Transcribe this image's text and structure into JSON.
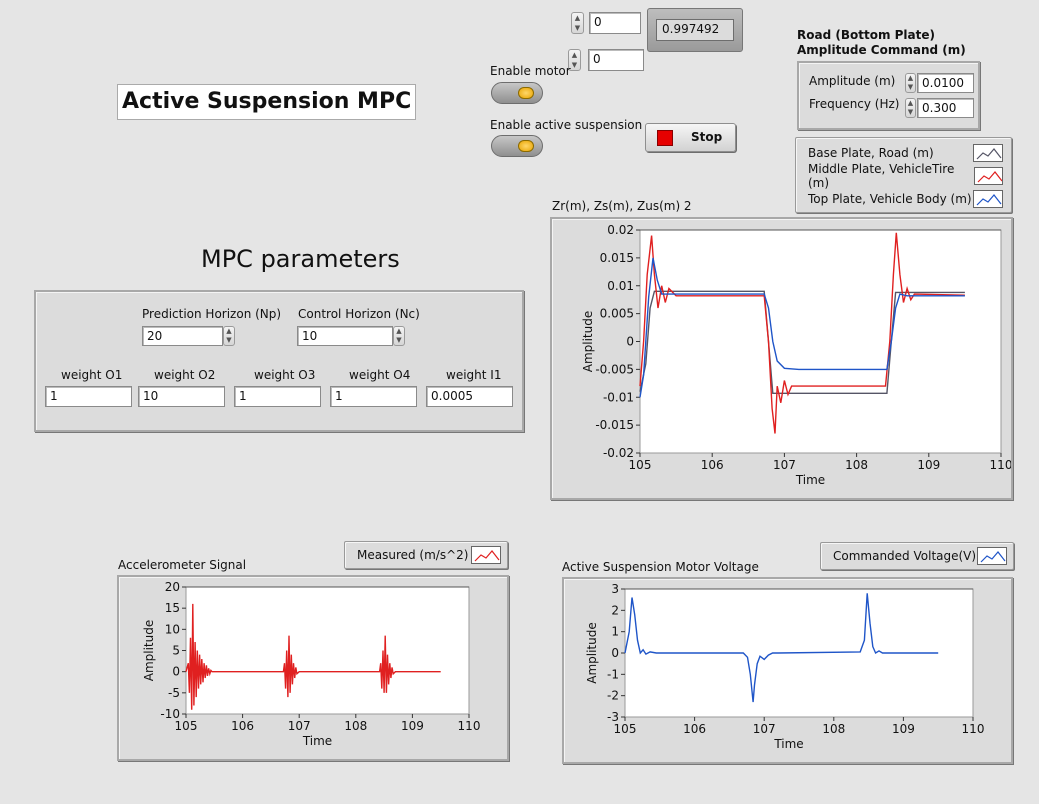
{
  "title": "Active Suspension MPC",
  "top_controls": {
    "numeric_1": "0",
    "numeric_2": "0",
    "indicator": "0.997492"
  },
  "enable_motor_label": "Enable motor",
  "enable_active_label": "Enable active suspension",
  "stop_label": "Stop",
  "road": {
    "title_line1": "Road (Bottom Plate)",
    "title_line2": "Amplitude Command (m)",
    "amplitude_label": "Amplitude (m)",
    "amplitude_value": "0.0100",
    "frequency_label": "Frequency (Hz)",
    "frequency_value": "0.300"
  },
  "plate_legend": [
    {
      "label": "Base Plate, Road (m)",
      "color": "#555566"
    },
    {
      "label": "Middle Plate, VehicleTire (m)",
      "color": "#e02020"
    },
    {
      "label": "Top Plate, Vehicle Body (m)",
      "color": "#1f55c8"
    }
  ],
  "mpc": {
    "heading": "MPC parameters",
    "np_label": "Prediction Horizon (Np)",
    "np_value": "20",
    "nc_label": "Control Horizon (Nc)",
    "nc_value": "10",
    "weights": [
      {
        "label": "weight O1",
        "value": "1"
      },
      {
        "label": "weight O2",
        "value": "10"
      },
      {
        "label": "weight O3",
        "value": "1"
      },
      {
        "label": "weight O4",
        "value": "1"
      },
      {
        "label": "weight I1",
        "value": "0.0005"
      }
    ]
  },
  "accel_legend": {
    "label": "Measured (m/s^2)",
    "color": "#e02020"
  },
  "voltage_legend": {
    "label": "Commanded Voltage(V)",
    "color": "#1f55c8"
  },
  "chart_data": [
    {
      "id": "plates",
      "type": "line",
      "title": "Zr(m), Zs(m), Zus(m) 2",
      "xlabel": "Time",
      "ylabel": "Amplitude",
      "xlim": [
        105,
        110
      ],
      "ylim": [
        -0.02,
        0.02
      ],
      "xticks": [
        105,
        106,
        107,
        108,
        109,
        110
      ],
      "yticks": [
        0.02,
        0.015,
        0.01,
        0.005,
        0,
        -0.005,
        -0.01,
        -0.015,
        -0.02
      ],
      "ytick_labels": [
        "0.02",
        "0.015",
        "0.01",
        "0.005",
        "0",
        "-0.005",
        "-0.01",
        "-0.015",
        "-0.02"
      ],
      "series": [
        {
          "color": "#555566",
          "x": [
            105,
            105.08,
            105.14,
            105.2,
            106.72,
            106.78,
            106.84,
            108.42,
            108.48,
            108.54,
            109.5
          ],
          "y": [
            -0.009,
            -0.004,
            0.006,
            0.009,
            0.009,
            0.0,
            -0.0093,
            -0.0093,
            0.0,
            0.0088,
            0.0088
          ]
        },
        {
          "color": "#e02020",
          "x": [
            105,
            105.05,
            105.1,
            105.16,
            105.2,
            105.25,
            105.3,
            105.35,
            105.4,
            105.5,
            106.72,
            106.78,
            106.83,
            106.87,
            106.9,
            106.95,
            107.0,
            107.05,
            107.1,
            107.2,
            108.4,
            108.46,
            108.51,
            108.55,
            108.6,
            108.65,
            108.7,
            108.75,
            108.8,
            109.5
          ],
          "y": [
            -0.008,
            0.0,
            0.012,
            0.019,
            0.012,
            0.006,
            0.01,
            0.007,
            0.0095,
            0.0082,
            0.0082,
            0.0,
            -0.012,
            -0.0165,
            -0.008,
            -0.011,
            -0.007,
            -0.0095,
            -0.008,
            -0.008,
            -0.008,
            0.0,
            0.012,
            0.0195,
            0.012,
            0.007,
            0.0095,
            0.0075,
            0.0085,
            0.0083
          ]
        },
        {
          "color": "#1f55c8",
          "x": [
            105,
            105.05,
            105.12,
            105.18,
            105.24,
            105.3,
            105.4,
            106.72,
            106.78,
            106.84,
            106.9,
            107.0,
            107.2,
            108.42,
            108.48,
            108.54,
            108.6,
            108.7,
            109.5
          ],
          "y": [
            -0.01,
            -0.006,
            0.008,
            0.015,
            0.011,
            0.0085,
            0.0085,
            0.0085,
            0.006,
            0.0,
            -0.0035,
            -0.0048,
            -0.005,
            -0.005,
            0.0,
            0.006,
            0.0085,
            0.0082,
            0.0082
          ]
        }
      ]
    },
    {
      "id": "accel",
      "type": "line",
      "title": "Accelerometer Signal",
      "xlabel": "Time",
      "ylabel": "Amplitude",
      "xlim": [
        105,
        110
      ],
      "ylim": [
        -10,
        20
      ],
      "xticks": [
        105,
        106,
        107,
        108,
        109,
        110
      ],
      "yticks": [
        20,
        15,
        10,
        5,
        0,
        -5,
        -10
      ],
      "ytick_labels": [
        "20",
        "15",
        "10",
        "5",
        "0",
        "-5",
        "-10"
      ],
      "series": [
        {
          "color": "#e02020",
          "x": [
            105,
            105.04,
            105.06,
            105.08,
            105.1,
            105.12,
            105.14,
            105.16,
            105.18,
            105.2,
            105.22,
            105.24,
            105.26,
            105.28,
            105.3,
            105.32,
            105.34,
            105.36,
            105.38,
            105.4,
            105.42,
            105.44,
            105.46,
            105.5,
            106.72,
            106.74,
            106.76,
            106.78,
            106.8,
            106.82,
            106.84,
            106.86,
            106.88,
            106.9,
            106.92,
            106.94,
            106.96,
            107.0,
            108.42,
            108.44,
            108.46,
            108.48,
            108.5,
            108.52,
            108.54,
            108.56,
            108.58,
            108.6,
            108.62,
            108.64,
            108.66,
            108.7,
            109.5
          ],
          "y": [
            0,
            2,
            -5,
            8,
            -9,
            16,
            -8,
            7,
            -6,
            5,
            -4,
            4,
            -3,
            3,
            -2.5,
            2,
            -1.5,
            1.5,
            -1,
            0.8,
            -0.5,
            0.3,
            0,
            0,
            0,
            2,
            -4,
            5,
            -6,
            8.5,
            -5,
            4,
            -3,
            2,
            -1.5,
            1,
            -0.5,
            0,
            0,
            2,
            -4,
            5,
            -5,
            8.5,
            -5,
            4,
            -3,
            2,
            -1.5,
            1,
            -0.5,
            0,
            0
          ]
        }
      ]
    },
    {
      "id": "voltage",
      "type": "line",
      "title": "Active Suspension Motor Voltage",
      "xlabel": "Time",
      "ylabel": "Amplitude",
      "xlim": [
        105,
        110
      ],
      "ylim": [
        -3,
        3
      ],
      "xticks": [
        105,
        106,
        107,
        108,
        109,
        110
      ],
      "yticks": [
        3,
        2,
        1,
        0,
        -1,
        -2,
        -3
      ],
      "ytick_labels": [
        "3",
        "2",
        "1",
        "0",
        "-1",
        "-2",
        "-3"
      ],
      "series": [
        {
          "color": "#1f55c8",
          "x": [
            105,
            105.06,
            105.1,
            105.14,
            105.18,
            105.22,
            105.26,
            105.3,
            105.36,
            105.45,
            106.7,
            106.76,
            106.8,
            106.84,
            106.86,
            106.9,
            106.94,
            107.0,
            107.06,
            107.12,
            107.2,
            108.38,
            108.44,
            108.48,
            108.52,
            108.56,
            108.6,
            108.65,
            108.7,
            109.5
          ],
          "y": [
            0,
            1.0,
            2.6,
            1.8,
            0.6,
            0.0,
            0.15,
            -0.05,
            0.05,
            0.0,
            0.0,
            -0.2,
            -1.0,
            -2.3,
            -1.5,
            -0.5,
            -0.15,
            -0.3,
            -0.1,
            0.0,
            0.0,
            0.05,
            0.6,
            2.8,
            1.4,
            0.3,
            0.0,
            0.1,
            0.0,
            0.0
          ]
        }
      ]
    }
  ]
}
